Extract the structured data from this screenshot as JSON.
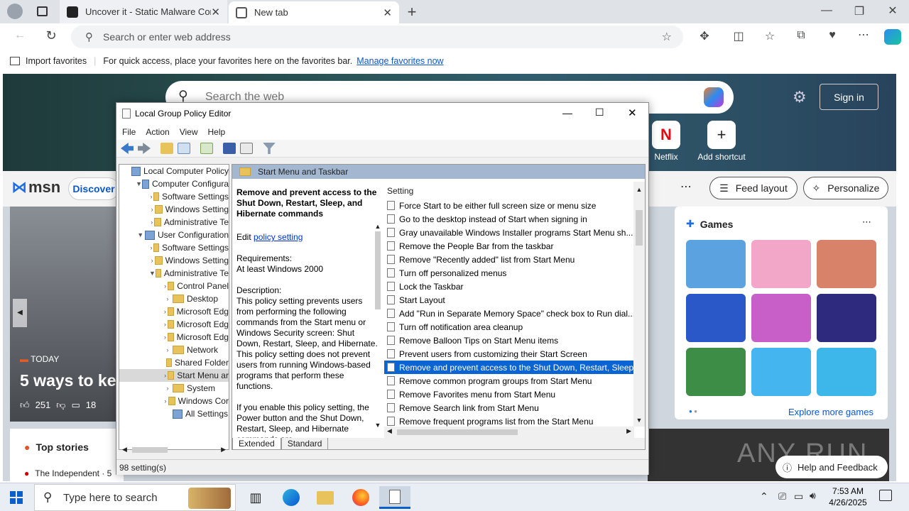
{
  "browser": {
    "tabs": [
      {
        "title": "Uncover it - Static Malware Confi",
        "icon": "shield-icon"
      },
      {
        "title": "New tab",
        "icon": "newtab-icon"
      }
    ],
    "address_placeholder": "Search or enter web address",
    "favorites": {
      "import_label": "Import favorites",
      "hint": "For quick access, place your favorites here on the favorites bar.",
      "manage_link": "Manage favorites now"
    }
  },
  "ntp": {
    "search_placeholder": "Search the web",
    "signin": "Sign in",
    "shortcuts": [
      {
        "label": "Netflix"
      },
      {
        "label": "Add shortcut"
      }
    ],
    "msn": "msn",
    "discover": "Discover",
    "feed_layout": "Feed layout",
    "personalize": "Personalize",
    "news": {
      "tag": "TODAY",
      "headline": "5 ways to ke",
      "likes": "251",
      "comments": "18"
    },
    "top_stories": "Top stories",
    "top_story_source": "The Independent · 5",
    "games_title": "Games",
    "explore_games": "Explore more games",
    "help_feedback": "Help and Feedback",
    "watermark": "ANY RUN"
  },
  "gpo": {
    "title": "Local Group Policy Editor",
    "menu": [
      "File",
      "Action",
      "View",
      "Help"
    ],
    "tree": [
      {
        "label": "Local Computer Policy",
        "indent": 0,
        "arrow": "",
        "icon": "pc"
      },
      {
        "label": "Computer Configura",
        "indent": 1,
        "arrow": "▼",
        "icon": "pc"
      },
      {
        "label": "Software Settings",
        "indent": 2,
        "arrow": "›",
        "icon": "folder"
      },
      {
        "label": "Windows Setting",
        "indent": 2,
        "arrow": "›",
        "icon": "folder"
      },
      {
        "label": "Administrative Te",
        "indent": 2,
        "arrow": "›",
        "icon": "folder"
      },
      {
        "label": "User Configuration",
        "indent": 1,
        "arrow": "▼",
        "icon": "pc"
      },
      {
        "label": "Software Settings",
        "indent": 2,
        "arrow": "›",
        "icon": "folder"
      },
      {
        "label": "Windows Setting",
        "indent": 2,
        "arrow": "›",
        "icon": "folder"
      },
      {
        "label": "Administrative Te",
        "indent": 2,
        "arrow": "▼",
        "icon": "folder"
      },
      {
        "label": "Control Panel",
        "indent": 3,
        "arrow": "›",
        "icon": "folder"
      },
      {
        "label": "Desktop",
        "indent": 3,
        "arrow": "›",
        "icon": "folder"
      },
      {
        "label": "Microsoft Edg",
        "indent": 3,
        "arrow": "›",
        "icon": "folder"
      },
      {
        "label": "Microsoft Edg",
        "indent": 3,
        "arrow": "›",
        "icon": "folder"
      },
      {
        "label": "Microsoft Edg",
        "indent": 3,
        "arrow": "›",
        "icon": "folder"
      },
      {
        "label": "Network",
        "indent": 3,
        "arrow": "›",
        "icon": "folder"
      },
      {
        "label": "Shared Folder",
        "indent": 3,
        "arrow": "",
        "icon": "folder"
      },
      {
        "label": "Start Menu ar",
        "indent": 3,
        "arrow": "›",
        "icon": "folder",
        "selected": true
      },
      {
        "label": "System",
        "indent": 3,
        "arrow": "›",
        "icon": "folder"
      },
      {
        "label": "Windows Cor",
        "indent": 3,
        "arrow": "›",
        "icon": "folder"
      },
      {
        "label": "All Settings",
        "indent": 3,
        "arrow": "",
        "icon": "settings"
      }
    ],
    "right_header": "Start Menu and Taskbar",
    "desc": {
      "title": "Remove and prevent access to the Shut Down, Restart, Sleep, and Hibernate commands",
      "edit_prefix": "Edit",
      "edit_link": "policy setting",
      "requirements_label": "Requirements:",
      "requirements": "At least Windows 2000",
      "description_label": "Description:",
      "description": "This policy setting prevents users from performing the following commands from the Start menu or Windows Security screen: Shut Down, Restart, Sleep, and Hibernate. This policy setting does not prevent users from running Windows-based programs that perform these functions.",
      "more": "If you enable this policy setting, the Power button and the Shut Down, Restart, Sleep, and Hibernate commands are"
    },
    "list_header": "Setting",
    "settings": [
      "Force Start to be either full screen size or menu size",
      "Go to the desktop instead of Start when signing in",
      "Gray unavailable Windows Installer programs Start Menu sh...",
      "Remove the People Bar from the taskbar",
      "Remove \"Recently added\" list from Start Menu",
      "Turn off personalized menus",
      "Lock the Taskbar",
      "Start Layout",
      "Add \"Run in Separate Memory Space\" check box to Run dial...",
      "Turn off notification area cleanup",
      "Remove Balloon Tips on Start Menu items",
      "Prevent users from customizing their Start Screen",
      "Remove and prevent access to the Shut Down, Restart, Sleep...",
      "Remove common program groups from Start Menu",
      "Remove Favorites menu from Start Menu",
      "Remove Search link from Start Menu",
      "Remove frequent programs list from the Start Menu"
    ],
    "selected_index": 12,
    "view_tabs": [
      "Extended",
      "Standard"
    ],
    "status": "98 setting(s)"
  },
  "taskbar": {
    "search_placeholder": "Type here to search",
    "time": "7:53 AM",
    "date": "4/26/2025"
  }
}
